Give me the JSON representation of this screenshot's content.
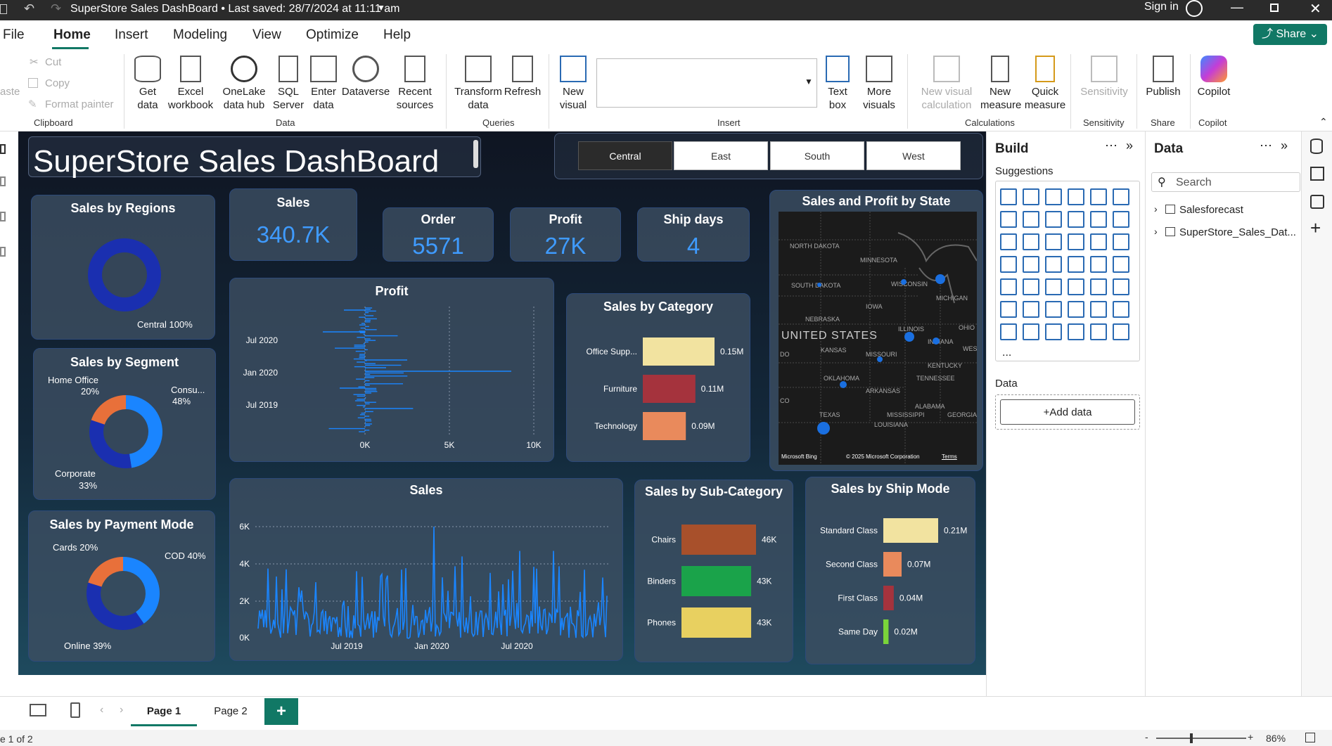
{
  "titlebar": {
    "title": "SuperStore Sales DashBoard • Last saved: 28/7/2024 at 11:11 am",
    "sign_in": "Sign in"
  },
  "menu": [
    "File",
    "Home",
    "Insert",
    "Modeling",
    "View",
    "Optimize",
    "Help"
  ],
  "share_label": "Share",
  "ribbon": {
    "clipboard": {
      "paste": "aste",
      "cut": "Cut",
      "copy": "Copy",
      "format_painter": "Format painter",
      "group": "Clipboard"
    },
    "data": {
      "get_data": "Get data",
      "excel": "Excel workbook",
      "onelake": "OneLake data hub",
      "sql": "SQL Server",
      "enter": "Enter data",
      "dataverse": "Dataverse",
      "recent": "Recent sources",
      "group": "Data"
    },
    "queries": {
      "transform": "Transform data",
      "refresh": "Refresh",
      "group": "Queries"
    },
    "insert": {
      "new_visual": "New visual",
      "text_box": "Text box",
      "more_visuals": "More visuals",
      "group": "Insert"
    },
    "calculations": {
      "new_visual_calc": "New visual calculation",
      "new_measure": "New measure",
      "quick_measure": "Quick measure",
      "group": "Calculations"
    },
    "sensitivity": {
      "label": "Sensitivity",
      "group": "Sensitivity"
    },
    "share": {
      "publish": "Publish",
      "group": "Share"
    },
    "copilot": {
      "label": "Copilot",
      "group": "Copilot"
    }
  },
  "dashboard": {
    "title": "SuperStore Sales DashBoard",
    "slicer": [
      "Central",
      "East",
      "South",
      "West"
    ],
    "kpis": [
      {
        "label": "Sales",
        "value": "340.7K"
      },
      {
        "label": "Order",
        "value": "5571"
      },
      {
        "label": "Profit",
        "value": "27K"
      },
      {
        "label": "Ship days",
        "value": "4"
      }
    ],
    "regions": {
      "title": "Sales by Regions",
      "label": "Central 100%"
    },
    "segment": {
      "title": "Sales by Segment",
      "labels": [
        "Home Office",
        "20%",
        "Consu...",
        "48%",
        "Corporate",
        "33%"
      ]
    },
    "payment": {
      "title": "Sales by Payment Mode",
      "labels": [
        "Cards 20%",
        "COD 40%",
        "Online 39%"
      ]
    },
    "profit_chart": {
      "title": "Profit",
      "y_ticks": [
        "Jul 2020",
        "Jan 2020",
        "Jul 2019"
      ],
      "x_ticks": [
        "0K",
        "5K",
        "10K"
      ]
    },
    "category": {
      "title": "Sales by Category"
    },
    "state_map": {
      "title": "Sales and Profit by State",
      "country": "UNITED STATES",
      "states": [
        "NORTH DAKOTA",
        "MINNESOTA",
        "WISCONSIN",
        "MICHIGAN",
        "SOUTH DAKOTA",
        "IOWA",
        "NEBRASKA",
        "ILLINOIS",
        "OHIO",
        "INDIANA",
        "KANSAS",
        "MISSOURI",
        "KENTUCKY",
        "OKLAHOMA",
        "TENNESSEE",
        "ARKANSAS",
        "ALABAMA",
        "TEXAS",
        "MISSISSIPPI",
        "GEORGIA",
        "LOUISIANA",
        "DO",
        "CO",
        "WES"
      ],
      "footer": "© 2025 Microsoft Corporation",
      "terms": "Terms",
      "bing": "Microsoft Bing"
    },
    "sales_chart": {
      "title": "Sales",
      "y_ticks": [
        "6K",
        "4K",
        "2K",
        "0K"
      ],
      "x_ticks": [
        "Jul 2019",
        "Jan 2020",
        "Jul 2020"
      ]
    },
    "subcategory": {
      "title": "Sales by Sub-Category"
    },
    "shipmode": {
      "title": "Sales by Ship Mode"
    }
  },
  "build": {
    "title": "Build",
    "suggestions": "Suggestions",
    "data_label": "Data",
    "add_data": "+Add data",
    "more": "..."
  },
  "datapane": {
    "title": "Data",
    "search": "Search",
    "items": [
      "Salesforecast",
      "SuperStore_Sales_Dat..."
    ]
  },
  "pages": {
    "tabs": [
      "Page 1",
      "Page 2"
    ],
    "add": "+"
  },
  "status": {
    "page": "e 1 of 2",
    "zoom": "86%"
  },
  "chart_data": [
    {
      "type": "pie",
      "title": "Sales by Regions",
      "categories": [
        "Central"
      ],
      "values": [
        100
      ],
      "colors": [
        "#1a2fb0"
      ]
    },
    {
      "type": "pie",
      "title": "Sales by Segment",
      "categories": [
        "Consumer",
        "Corporate",
        "Home Office"
      ],
      "values": [
        48,
        33,
        20
      ],
      "colors": [
        "#1a85ff",
        "#1a2fb0",
        "#e8703a"
      ]
    },
    {
      "type": "pie",
      "title": "Sales by Payment Mode",
      "categories": [
        "COD",
        "Online",
        "Cards"
      ],
      "values": [
        40,
        39,
        20
      ],
      "colors": [
        "#1a85ff",
        "#1a2fb0",
        "#e8703a"
      ]
    },
    {
      "type": "bar",
      "title": "Sales by Category",
      "categories": [
        "Office Supp...",
        "Furniture",
        "Technology"
      ],
      "values": [
        0.15,
        0.11,
        0.09
      ],
      "labels": [
        "0.15M",
        "0.11M",
        "0.09M"
      ],
      "colors": [
        "#f2e3a0",
        "#a5333d",
        "#e98a5c"
      ],
      "xlim": [
        0,
        0.15
      ]
    },
    {
      "type": "bar",
      "title": "Sales by Sub-Category",
      "categories": [
        "Chairs",
        "Binders",
        "Phones"
      ],
      "values": [
        46,
        43,
        43
      ],
      "labels": [
        "46K",
        "43K",
        "43K"
      ],
      "colors": [
        "#a8502b",
        "#1aa34a",
        "#e8d060"
      ],
      "xlim": [
        0,
        46
      ]
    },
    {
      "type": "bar",
      "title": "Sales by Ship Mode",
      "categories": [
        "Standard Class",
        "Second Class",
        "First Class",
        "Same Day"
      ],
      "values": [
        0.21,
        0.07,
        0.04,
        0.02
      ],
      "labels": [
        "0.21M",
        "0.07M",
        "0.04M",
        "0.02M"
      ],
      "colors": [
        "#f2e3a0",
        "#e98a5c",
        "#a5333d",
        "#7ad43a"
      ],
      "xlim": [
        0,
        0.21
      ]
    }
  ],
  "colors": {
    "accent": "#1a7f5a",
    "bar_blue": "#1a85ff"
  }
}
